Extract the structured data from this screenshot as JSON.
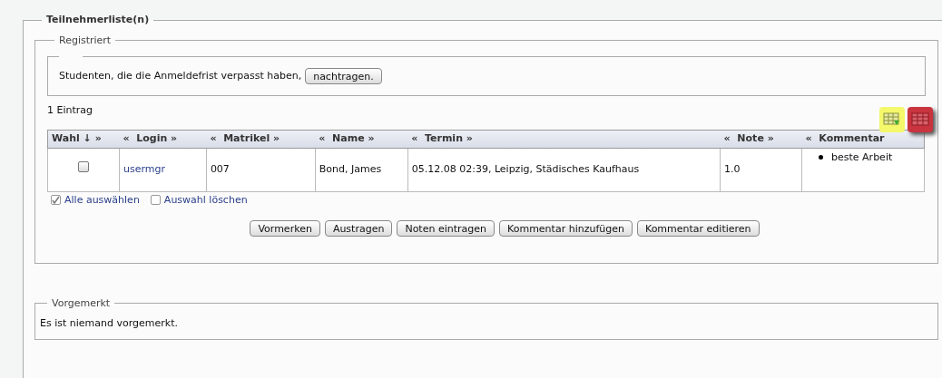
{
  "panel": {
    "title": "Teilnehmerliste(n)"
  },
  "registered": {
    "title": "Registriert",
    "late_text": "Studenten, die die Anmeldefrist verpasst haben,",
    "late_button": "nachtragen.",
    "count": "1 Eintrag",
    "table": {
      "columns": [
        "Wahl ↓ »",
        "«  Login »",
        "«  Matrikel »",
        "«  Name »",
        "«  Termin »",
        "«  Note »",
        "«  Kommentar"
      ],
      "rows": [
        {
          "checked": false,
          "login": "usermgr",
          "matrikel": "007",
          "name": "Bond, James",
          "termin": "05.12.08 02:39, Leipzig, Städisches Kaufhaus",
          "note": "1.0",
          "kommentar": [
            "beste Arbeit"
          ]
        }
      ]
    },
    "select_all": {
      "label": "Alle auswählen",
      "checked": true
    },
    "clear_selection": {
      "label": "Auswahl löschen",
      "checked": false
    },
    "buttons": [
      "Vormerken",
      "Austragen",
      "Noten eintragen",
      "Kommentar hinzufügen",
      "Kommentar editieren"
    ]
  },
  "reserved": {
    "title": "Vorgemerkt",
    "text": "Es ist niemand vorgemerkt."
  }
}
